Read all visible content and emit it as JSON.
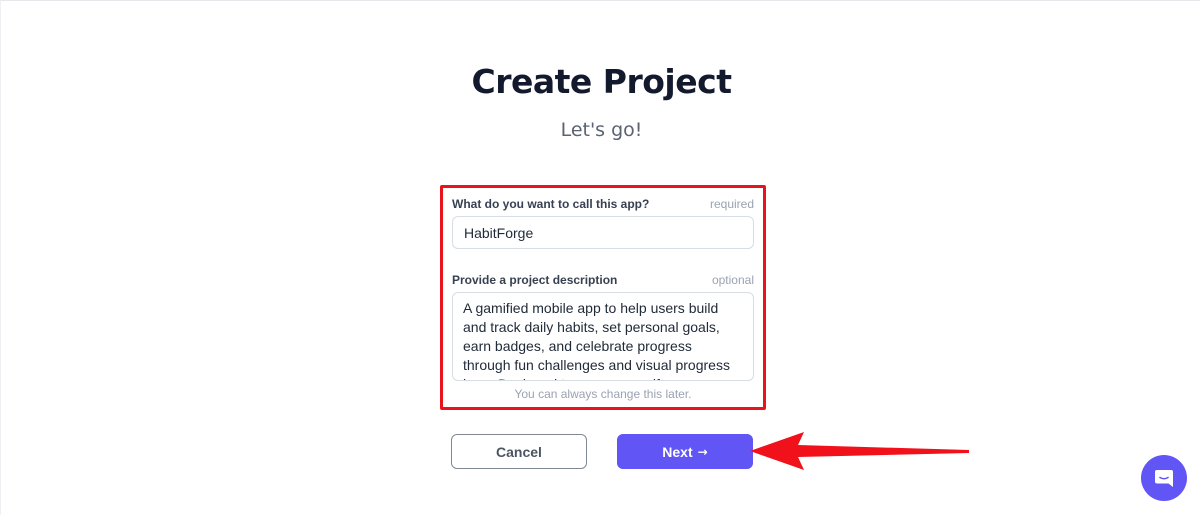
{
  "header": {
    "title": "Create Project",
    "subtitle": "Let's go!"
  },
  "form": {
    "name_field": {
      "label": "What do you want to call this app?",
      "hint": "required",
      "value": "HabitForge"
    },
    "description_field": {
      "label": "Provide a project description",
      "hint": "optional",
      "value": "A gamified mobile app to help users build and track daily habits, set personal goals, earn badges, and celebrate progress through fun challenges and visual progress bars. Designed to empower self-"
    },
    "helper_text": "You can always change this later."
  },
  "actions": {
    "cancel_label": "Cancel",
    "next_label": "Next",
    "next_arrow": "→"
  },
  "colors": {
    "primary": "#6155f5",
    "highlight": "#e8141c",
    "title": "#141a2e"
  },
  "icons": {
    "next_arrow": "arrow-right-icon",
    "annotation": "red-pointer-arrow-icon",
    "chat": "chat-bubble-icon"
  }
}
